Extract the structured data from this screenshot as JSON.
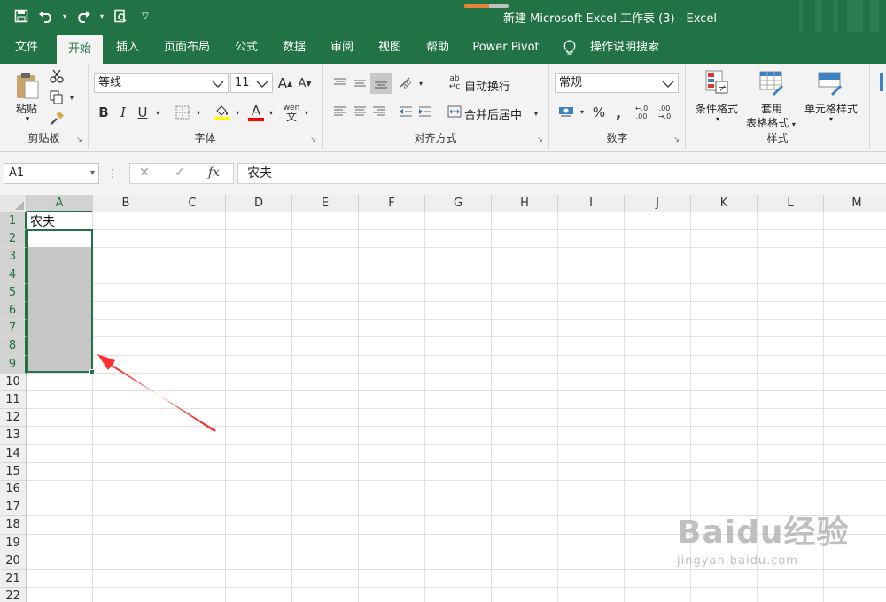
{
  "window": {
    "title": "新建 Microsoft Excel 工作表 (3)  -  Excel",
    "accent": "#217346",
    "progress_fraction": 0.55
  },
  "qat": {
    "icons": [
      "save-icon",
      "undo-icon",
      "redo-icon",
      "print-preview-icon",
      "customize-qat-icon"
    ]
  },
  "tabs": [
    "文件",
    "开始",
    "插入",
    "页面布局",
    "公式",
    "数据",
    "审阅",
    "视图",
    "帮助",
    "Power Pivot",
    "操作说明搜索"
  ],
  "active_tab": "开始",
  "ribbon": {
    "clipboard": {
      "label": "剪贴板",
      "paste": "粘贴"
    },
    "font": {
      "label": "字体",
      "name": "等线",
      "size": "11",
      "grow": "A",
      "shrink": "A",
      "bold": "B",
      "italic": "I",
      "underline": "U",
      "font_color": "A",
      "highlight": "ab",
      "phonetic": "wén"
    },
    "align": {
      "label": "对齐方式",
      "wrap": "自动换行",
      "merge": "合并后居中"
    },
    "number": {
      "label": "数字",
      "format": "常规",
      "percent": "%",
      "comma": ",",
      "inc_decimal": ".00",
      "dec_decimal": ".00"
    },
    "styles": {
      "label": "样式",
      "conditional": "条件格式",
      "table": "套用\n表格格式",
      "table_line1": "套用",
      "table_line2": "表格格式",
      "cell": "单元格样式"
    }
  },
  "formula_bar": {
    "name_box": "A1",
    "fx": "fx",
    "content": "农夫"
  },
  "sheet": {
    "columns": [
      "A",
      "B",
      "C",
      "D",
      "E",
      "F",
      "G",
      "H",
      "I",
      "J",
      "K",
      "L",
      "M"
    ],
    "rows": [
      "1",
      "2",
      "3",
      "4",
      "5",
      "6",
      "7",
      "8",
      "9",
      "10",
      "11",
      "12",
      "13",
      "14",
      "15",
      "16",
      "17",
      "18",
      "19",
      "20",
      "21",
      "22"
    ],
    "selected_column": "A",
    "selected_rows": [
      "1",
      "2",
      "3",
      "4",
      "5",
      "6",
      "7",
      "8",
      "9"
    ],
    "cells": {
      "A1": "农夫"
    }
  },
  "watermark": {
    "logo_text": "Baidu经验",
    "url_text": "jingyan.baidu.com"
  }
}
